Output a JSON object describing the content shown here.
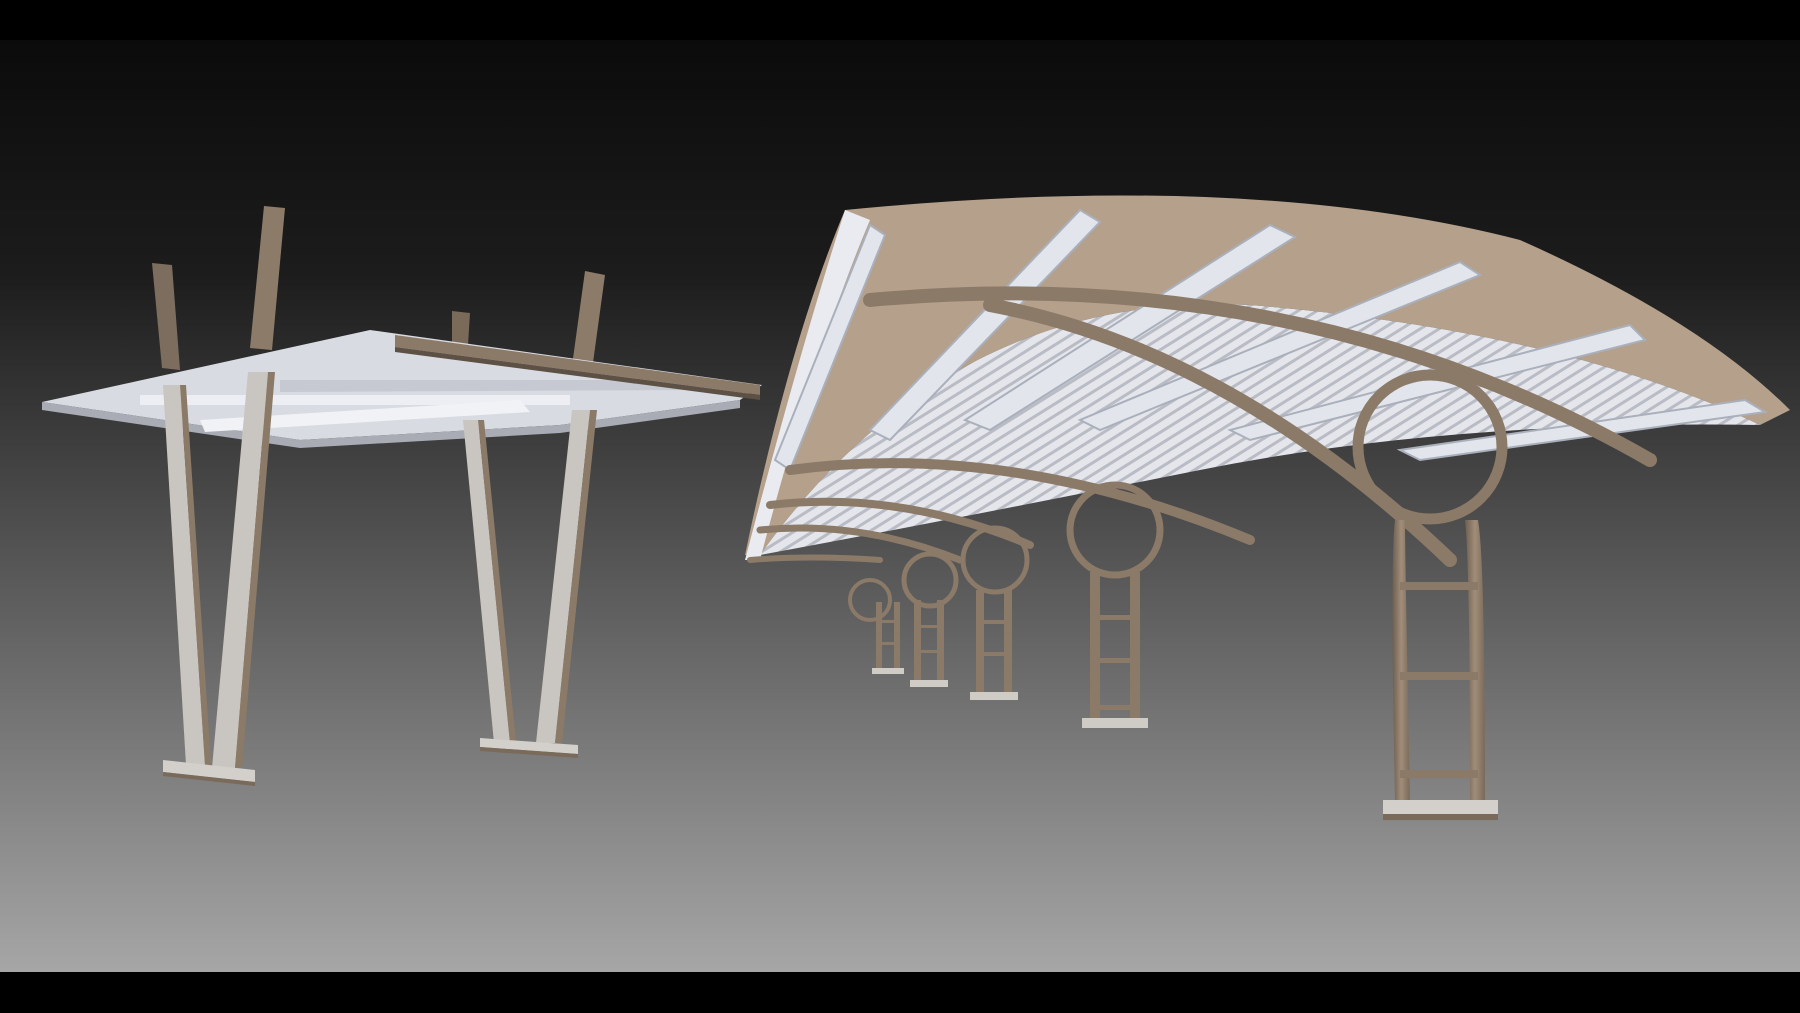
{
  "scene": {
    "description_free": true,
    "colors": {
      "background_top": "#0b0b0b",
      "background_bottom": "#a6a6a6",
      "steel_brown": "#8c7a68",
      "steel_brown_light": "#b3a08c",
      "roof_white": "#e6e8ee",
      "roof_shadow": "#b9bcc5",
      "letterbox": "#000000"
    },
    "objects": [
      {
        "name": "flat-canopy",
        "parts": [
          "roof-slab",
          "roof-beams",
          "v-columns",
          "base-plates"
        ]
      },
      {
        "name": "curved-canopy",
        "parts": [
          "curved-roof",
          "roof-purlins",
          "arched-trusses",
          "circle-braces",
          "ladder-columns",
          "base-plates"
        ]
      }
    ]
  }
}
